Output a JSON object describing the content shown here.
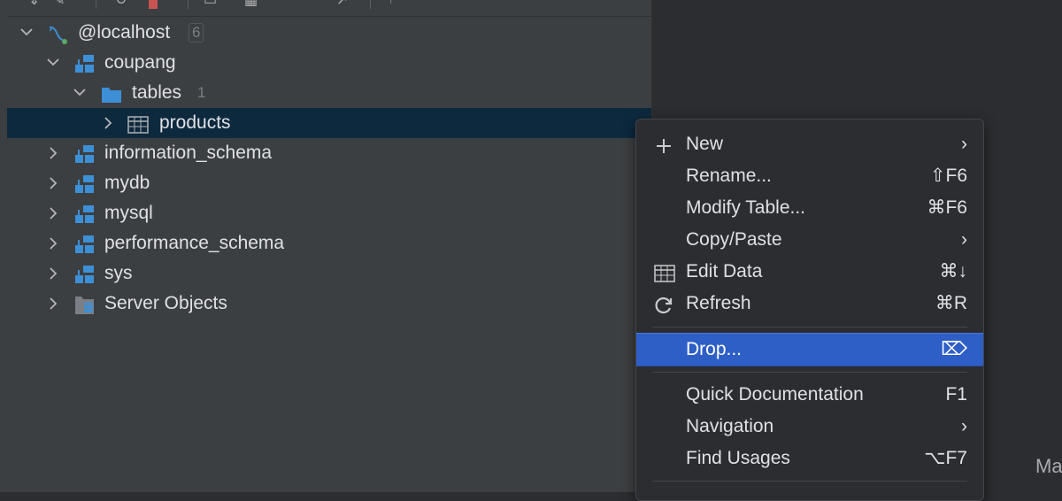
{
  "tree": {
    "root": {
      "label": "@localhost",
      "count": "6"
    },
    "schemas": [
      {
        "label": "coupang"
      },
      {
        "label": "information_schema"
      },
      {
        "label": "mydb"
      },
      {
        "label": "mysql"
      },
      {
        "label": "performance_schema"
      },
      {
        "label": "sys"
      }
    ],
    "tables_folder": {
      "label": "tables",
      "count": "1"
    },
    "table": {
      "label": "products"
    },
    "server_objects": {
      "label": "Server Objects"
    }
  },
  "context_menu": {
    "items": [
      {
        "label": "New",
        "shortcut": "›"
      },
      {
        "label": "Rename...",
        "shortcut": "⇧F6"
      },
      {
        "label": "Modify Table...",
        "shortcut": "⌘F6"
      },
      {
        "label": "Copy/Paste",
        "shortcut": "›"
      },
      {
        "label": "Edit Data",
        "shortcut": "⌘↓"
      },
      {
        "label": "Refresh",
        "shortcut": "⌘R"
      },
      {
        "label": "Drop...",
        "shortcut": "⌦"
      },
      {
        "label": "Quick Documentation",
        "shortcut": "F1"
      },
      {
        "label": "Navigation",
        "shortcut": "›"
      },
      {
        "label": "Find Usages",
        "shortcut": "⌥F7"
      }
    ]
  },
  "editor": {
    "partial_text": "Ma"
  },
  "colors": {
    "panel_bg": "#3c3f41",
    "selection_bg": "#0d293e",
    "menu_bg": "#2b2d30",
    "menu_highlight": "#2e5fc7",
    "schema_icon": "#3d8fd6"
  },
  "icons": {
    "root": "mysql-datasource-icon",
    "schema": "schema-icon",
    "folder": "folder-icon",
    "table": "table-icon",
    "server_objects": "server-objects-icon",
    "new": "plus-icon",
    "edit_data": "table-grid-icon",
    "refresh": "refresh-icon",
    "drop": "delete-key-icon"
  }
}
